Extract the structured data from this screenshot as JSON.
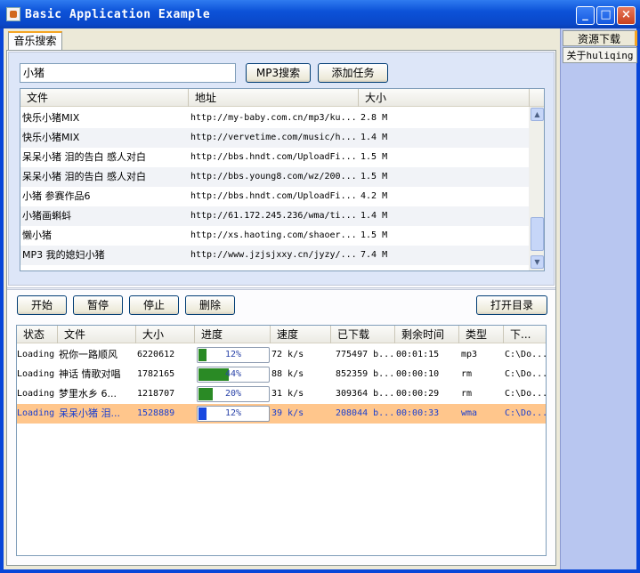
{
  "window": {
    "title": "Basic Application Example",
    "min_label": "_",
    "max_label": "□",
    "close_label": "×"
  },
  "main_tab": "音乐搜索",
  "right_tabs": [
    "资源下载",
    "关于huliqing"
  ],
  "search": {
    "value": "小猪",
    "search_button": "MP3搜索",
    "add_task_button": "添加任务"
  },
  "results": {
    "columns": [
      "文件",
      "地址",
      "大小"
    ],
    "rows": [
      {
        "file": "快乐小猪MIX",
        "url": "http://my-baby.com.cn/mp3/ku...",
        "size": "2.8 M"
      },
      {
        "file": "快乐小猪MIX",
        "url": "http://vervetime.com/music/h...",
        "size": "1.4 M"
      },
      {
        "file": "呆呆小猪 泪的告白 感人对白",
        "url": "http://bbs.hndt.com/UploadFi...",
        "size": "1.5 M"
      },
      {
        "file": "呆呆小猪 泪的告白 感人对白",
        "url": "http://bbs.young8.com/wz/200...",
        "size": "1.5 M"
      },
      {
        "file": "小猪  参赛作品6",
        "url": "http://bbs.hndt.com/UploadFi...",
        "size": "4.2 M"
      },
      {
        "file": "小猪画蝌蚪",
        "url": "http://61.172.245.236/wma/ti...",
        "size": "1.4 M"
      },
      {
        "file": "懒小猪",
        "url": "http://xs.haoting.com/shaoer...",
        "size": "1.5 M"
      },
      {
        "file": "MP3 我的媳妇小猪",
        "url": "http://www.jzjsjxxy.cn/jyzy/...",
        "size": "7.4 M"
      }
    ]
  },
  "controls": {
    "start": "开始",
    "pause": "暂停",
    "stop": "停止",
    "delete": "删除",
    "open_dir": "打开目录"
  },
  "downloads": {
    "columns": [
      "状态",
      "文件",
      "大小",
      "进度",
      "速度",
      "已下载",
      "剩余时间",
      "类型",
      "下..."
    ],
    "rows": [
      {
        "status": "Loading",
        "file": "祝你一路顺风",
        "size": "6220612",
        "progress": 0.12,
        "progress_text": "12%",
        "speed": "72 k/s",
        "downloaded": "775497 b...",
        "remaining": "00:01:15",
        "type": "mp3",
        "path": "C:\\Do..."
      },
      {
        "status": "Loading",
        "file": "神话  情歌对唱",
        "size": "1782165",
        "progress": 0.44,
        "progress_text": "44%",
        "speed": "88 k/s",
        "downloaded": "852359 b...",
        "remaining": "00:00:10",
        "type": "rm",
        "path": "C:\\Do..."
      },
      {
        "status": "Loading",
        "file": "梦里水乡  6...",
        "size": "1218707",
        "progress": 0.2,
        "progress_text": "20%",
        "speed": "31 k/s",
        "downloaded": "309364 b...",
        "remaining": "00:00:29",
        "type": "rm",
        "path": "C:\\Do..."
      },
      {
        "status": "Loading",
        "file": "呆呆小猪 泪...",
        "size": "1528889",
        "progress": 0.12,
        "progress_text": "12%",
        "speed": "39 k/s",
        "downloaded": "208044 b...",
        "remaining": "00:00:33",
        "type": "wma",
        "path": "C:\\Do...",
        "selected": true
      }
    ]
  }
}
